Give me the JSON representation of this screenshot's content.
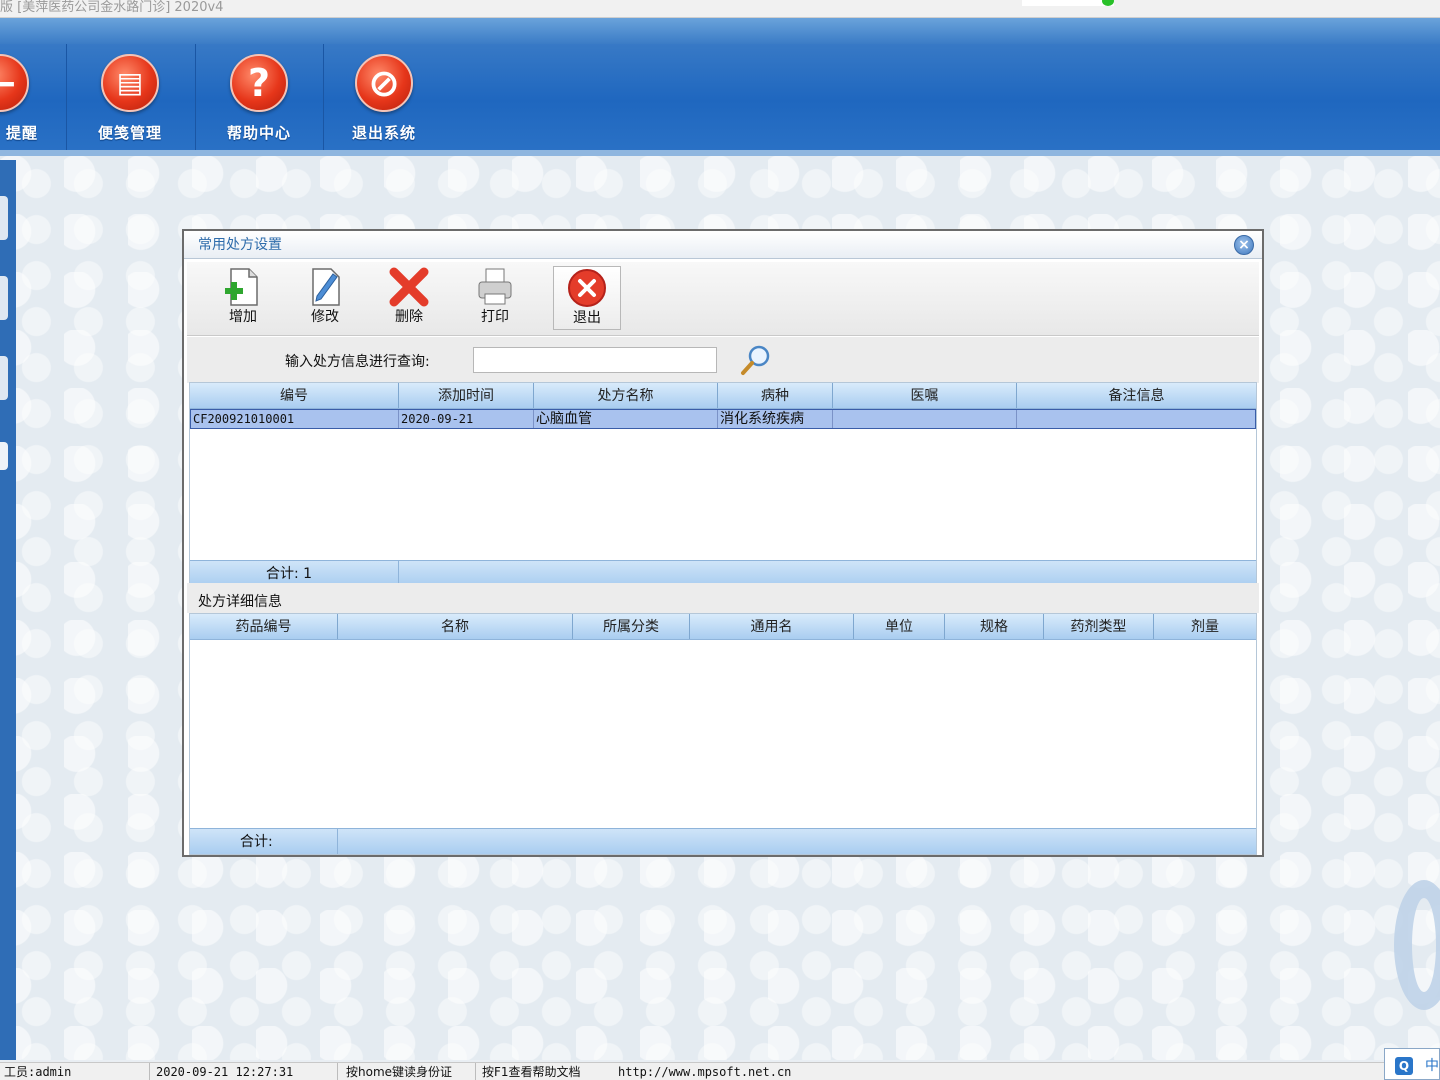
{
  "window": {
    "title": "版 [美萍医药公司金水路门诊]   2020v4"
  },
  "main_toolbar": {
    "items": [
      {
        "label": "提醒",
        "icon": "reminder-icon"
      },
      {
        "label": "便笺管理",
        "icon": "notepad-icon"
      },
      {
        "label": "帮助中心",
        "icon": "help-icon"
      },
      {
        "label": "退出系统",
        "icon": "exit-system-icon"
      }
    ]
  },
  "dialog": {
    "title": "常用处方设置",
    "toolbar": {
      "add": "增加",
      "edit": "修改",
      "delete": "删除",
      "print": "打印",
      "exit": "退出"
    },
    "search": {
      "label": "输入处方信息进行查询:",
      "value": "",
      "placeholder": ""
    },
    "prescription_table": {
      "columns": [
        "编号",
        "添加时间",
        "处方名称",
        "病种",
        "医嘱",
        "备注信息"
      ],
      "rows": [
        [
          "CF200921010001",
          "2020-09-21",
          "心脑血管",
          "消化系统疾病",
          "",
          ""
        ]
      ],
      "total_label": "合计: 1"
    },
    "detail_section_label": "处方详细信息",
    "detail_table": {
      "columns": [
        "药品编号",
        "名称",
        "所属分类",
        "通用名",
        "单位",
        "规格",
        "药剂类型",
        "剂量"
      ],
      "rows": [],
      "total_label": "合计:"
    }
  },
  "statusbar": {
    "user": "工员:admin",
    "datetime": "2020-09-21 12:27:31",
    "hint1": "按home键读身份证",
    "hint2": "按F1查看帮助文档",
    "url": "http://www.mpsoft.net.cn"
  },
  "tray": {
    "ime": "中"
  },
  "colors": {
    "banner_blue": "#1f67bf",
    "toolbar_icon_red": "#e6361a",
    "selected_row": "#a9c2ee",
    "grid_header": "#a9cdf0"
  }
}
